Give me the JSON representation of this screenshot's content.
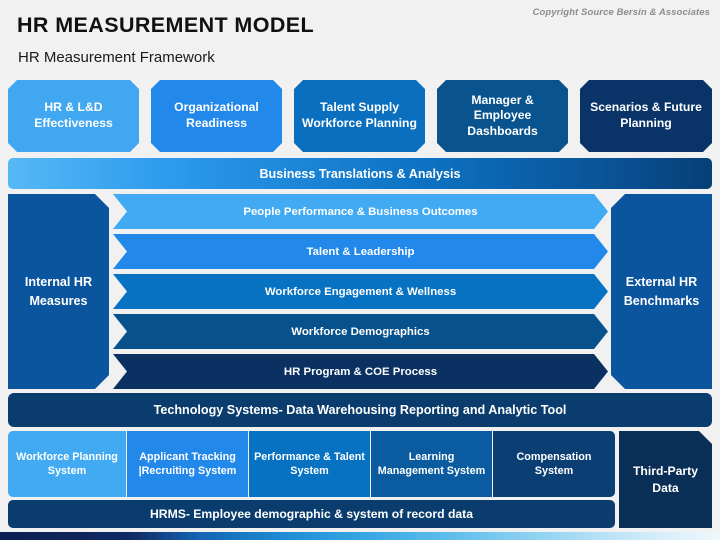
{
  "header": {
    "title": "HR MEASUREMENT MODEL",
    "subtitle": "HR Measurement Framework",
    "copyright": "Copyright Source Bersin & Associates"
  },
  "top_row": [
    {
      "label": "HR & L&D Effectiveness",
      "color": "#41a7f0"
    },
    {
      "label": "Organizational Readiness",
      "color": "#2288ea"
    },
    {
      "label": "Talent Supply Workforce Planning",
      "color": "#0b6fc0"
    },
    {
      "label": "Manager & Employee Dashboards",
      "color": "#09538f"
    },
    {
      "label": "Scenarios & Future Planning",
      "color": "#0a3468"
    }
  ],
  "business_bar": {
    "label": "Business Translations & Analysis",
    "gradient_from": "#56b9f5",
    "gradient_to": "#073f77"
  },
  "panels": {
    "left": {
      "label": "Internal HR Measures",
      "color": "#0b559e"
    },
    "right": {
      "label": "External HR Benchmarks",
      "color": "#0b559e"
    }
  },
  "measures": [
    {
      "label": "People Performance & Business Outcomes",
      "color": "#41aaf2"
    },
    {
      "label": "Talent & Leadership",
      "color": "#2288ea"
    },
    {
      "label": "Workforce Engagement & Wellness",
      "color": "#0772c2"
    },
    {
      "label": "Workforce Demographics",
      "color": "#07528d"
    },
    {
      "label": "HR Program & COE Process",
      "color": "#0a3162"
    }
  ],
  "technology_bar": {
    "label": "Technology Systems- Data Warehousing Reporting and Analytic Tool",
    "color": "#0a3c6e"
  },
  "systems": [
    {
      "label": "Workforce Planning System",
      "color": "#41aaf2"
    },
    {
      "label": "Applicant Tracking |Recruiting System",
      "color": "#2288ea"
    },
    {
      "label": "Performance & Talent System",
      "color": "#0772c2"
    },
    {
      "label": "Learning Management System",
      "color": "#0a5b9f"
    },
    {
      "label": "Compensation System",
      "color": "#0b3f74"
    },
    {
      "label": "Third-Party Data",
      "color": "#0a2f56"
    }
  ],
  "hrms_bar": {
    "label": "HRMS- Employee demographic & system of record data",
    "color": "#0a3c6e"
  }
}
